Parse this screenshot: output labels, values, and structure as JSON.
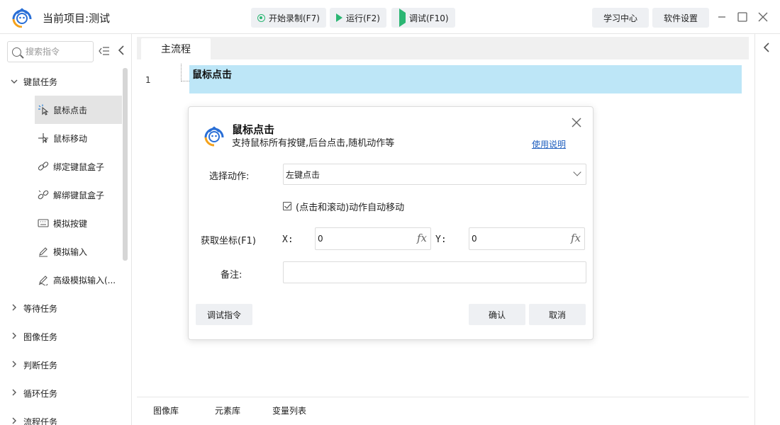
{
  "titlebar": {
    "title": "当前项目:测试",
    "record_label": "开始录制(F7)",
    "run_label": "运行(F2)",
    "debug_label": "调试(F10)",
    "learn_label": "学习中心",
    "settings_label": "软件设置"
  },
  "sidebar": {
    "search_placeholder": "搜索指令",
    "group_keymouse": "键鼠任务",
    "items": [
      {
        "label": "鼠标点击",
        "icon": "mouse-click-icon"
      },
      {
        "label": "鼠标移动",
        "icon": "mouse-move-icon"
      },
      {
        "label": "绑定键鼠盒子",
        "icon": "link-icon"
      },
      {
        "label": "解绑键鼠盒子",
        "icon": "unlink-icon"
      },
      {
        "label": "模拟按键",
        "icon": "keyboard-icon"
      },
      {
        "label": "模拟输入",
        "icon": "pen-icon"
      },
      {
        "label": "高级模拟输入(...",
        "icon": "advanced-pen-icon"
      }
    ],
    "groups": [
      "等待任务",
      "图像任务",
      "判断任务",
      "循环任务",
      "流程任务"
    ]
  },
  "main": {
    "tab_label": "主流程",
    "line_number": "1",
    "line_text": "鼠标点击"
  },
  "bottom_tabs": [
    "图像库",
    "元素库",
    "变量列表"
  ],
  "dialog": {
    "title": "鼠标点击",
    "subtitle": "支持鼠标所有按键,后台点击,随机动作等",
    "help_link": "使用说明",
    "action_label": "选择动作:",
    "action_value": "左键点击",
    "auto_move_label": "(点击和滚动)动作自动移动",
    "auto_move_checked": true,
    "coord_label": "获取坐标(F1)",
    "x_label": "X:",
    "x_value": "0",
    "y_label": "Y:",
    "y_value": "0",
    "fx_symbol": "fx",
    "note_label": "备注:",
    "note_value": "",
    "debug_button": "调试指令",
    "ok_button": "确认",
    "cancel_button": "取消"
  },
  "colors": {
    "accent_green": "#2bb673",
    "selected_line": "#bde6f7",
    "link_blue": "#1f5fbf"
  }
}
